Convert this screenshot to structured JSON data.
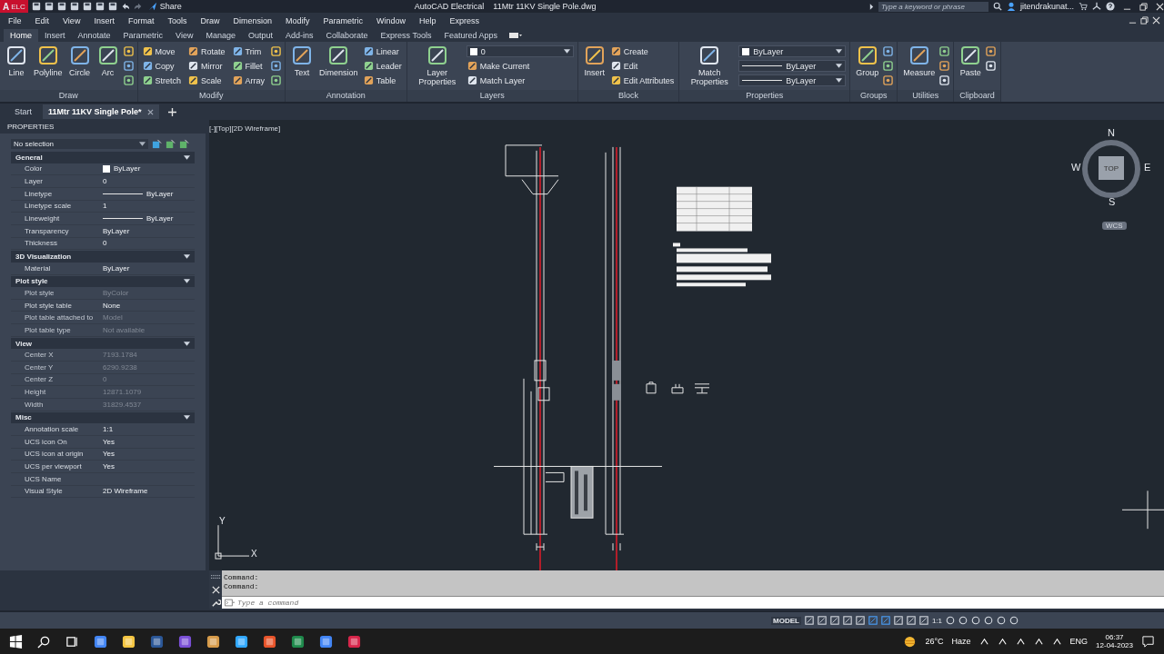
{
  "title_bar": {
    "app_letter": "A",
    "app_badge": "ELC",
    "share": "Share",
    "title": "AutoCAD Electrical    11Mtr 11KV Single Pole.dwg",
    "search": {
      "placeholder": "Type a keyword or phrase"
    },
    "user": "jitendrakunat..."
  },
  "menu": [
    "File",
    "Edit",
    "View",
    "Insert",
    "Format",
    "Tools",
    "Draw",
    "Dimension",
    "Modify",
    "Parametric",
    "Window",
    "Help",
    "Express"
  ],
  "ribbon_tabs": [
    {
      "label": "Home",
      "selected": true
    },
    {
      "label": "Insert",
      "selected": false
    },
    {
      "label": "Annotate",
      "selected": false
    },
    {
      "label": "Parametric",
      "selected": false
    },
    {
      "label": "View",
      "selected": false
    },
    {
      "label": "Manage",
      "selected": false
    },
    {
      "label": "Output",
      "selected": false
    },
    {
      "label": "Add-ins",
      "selected": false
    },
    {
      "label": "Collaborate",
      "selected": false
    },
    {
      "label": "Express Tools",
      "selected": false
    },
    {
      "label": "Featured Apps",
      "selected": false
    }
  ],
  "ribbon_panels": [
    {
      "title": "Draw",
      "large": [
        "Line",
        "Polyline",
        "Circle",
        "Arc"
      ],
      "small": [
        {
          "kind": "icon"
        },
        {
          "kind": "icon"
        },
        {
          "kind": "icon"
        }
      ]
    },
    {
      "title": "Modify",
      "small": [
        {
          "kind": "tool",
          "label": "Move"
        },
        {
          "kind": "tool",
          "label": "Copy"
        },
        {
          "kind": "tool",
          "label": "Stretch"
        },
        {
          "kind": "tool",
          "label": "Rotate"
        },
        {
          "kind": "tool",
          "label": "Mirror"
        },
        {
          "kind": "tool",
          "label": "Scale"
        },
        {
          "kind": "tool",
          "label": "Trim"
        },
        {
          "kind": "tool",
          "label": "Fillet"
        },
        {
          "kind": "tool",
          "label": "Array"
        },
        {
          "kind": "icon"
        },
        {
          "kind": "icon"
        },
        {
          "kind": "icon"
        }
      ]
    },
    {
      "title": "Annotation",
      "large": [
        "Text",
        "Dimension"
      ],
      "small": [
        {
          "kind": "tool",
          "label": "Linear"
        },
        {
          "kind": "tool",
          "label": "Leader"
        },
        {
          "kind": "tool",
          "label": "Table"
        }
      ]
    },
    {
      "title": "Layers",
      "large": [
        "Layer Properties"
      ],
      "small": [
        {
          "kind": "color-dropdown",
          "value": "0"
        },
        {
          "kind": "tool",
          "label": "Make Current"
        },
        {
          "kind": "tool",
          "label": "Match Layer"
        }
      ]
    },
    {
      "title": "Block",
      "large": [
        "Insert"
      ],
      "small": [
        {
          "kind": "tool",
          "label": "Create"
        },
        {
          "kind": "tool",
          "label": "Edit"
        },
        {
          "kind": "tool",
          "label": "Edit Attributes"
        }
      ]
    },
    {
      "title": "Properties",
      "large": [
        "Match Properties"
      ],
      "small": [
        {
          "kind": "color-dropdown",
          "value": "ByLayer"
        },
        {
          "kind": "line-dropdown",
          "value": "ByLayer"
        },
        {
          "kind": "line-dropdown",
          "value": "ByLayer"
        }
      ]
    },
    {
      "title": "Groups",
      "large": [
        "Group"
      ],
      "small": [
        {
          "kind": "icon"
        },
        {
          "kind": "icon"
        },
        {
          "kind": "icon"
        }
      ]
    },
    {
      "title": "Utilities",
      "large": [
        "Measure"
      ],
      "small": [
        {
          "kind": "icon"
        },
        {
          "kind": "icon"
        },
        {
          "kind": "icon"
        }
      ]
    },
    {
      "title": "Clipboard",
      "large": [
        "Paste"
      ],
      "small": [
        {
          "kind": "icon"
        },
        {
          "kind": "icon"
        }
      ]
    }
  ],
  "file_tabs": [
    {
      "label": "Start",
      "selected": false
    },
    {
      "label": "11Mtr 11KV Single Pole*",
      "selected": true
    }
  ],
  "properties": {
    "header": "PROPERTIES",
    "selection": "No selection",
    "sections": [
      {
        "title": "General",
        "rows": [
          {
            "label": "Color",
            "value": "ByLayer",
            "kind": "swatch",
            "dimmed": false
          },
          {
            "label": "Layer",
            "value": "0",
            "kind": "text",
            "dimmed": false
          },
          {
            "label": "Linetype",
            "value": "ByLayer",
            "kind": "line",
            "dimmed": false
          },
          {
            "label": "Linetype scale",
            "value": "1",
            "kind": "text",
            "dimmed": false
          },
          {
            "label": "Lineweight",
            "value": "ByLayer",
            "kind": "line",
            "dimmed": false
          },
          {
            "label": "Transparency",
            "value": "ByLayer",
            "kind": "text",
            "dimmed": false
          },
          {
            "label": "Thickness",
            "value": "0",
            "kind": "text",
            "dimmed": false
          }
        ]
      },
      {
        "title": "3D Visualization",
        "rows": [
          {
            "label": "Material",
            "value": "ByLayer",
            "kind": "text",
            "dimmed": false
          }
        ]
      },
      {
        "title": "Plot style",
        "rows": [
          {
            "label": "Plot style",
            "value": "ByColor",
            "kind": "text",
            "dimmed": true
          },
          {
            "label": "Plot style table",
            "value": "None",
            "kind": "text",
            "dimmed": false
          },
          {
            "label": "Plot table attached to",
            "value": "Model",
            "kind": "text",
            "dimmed": true
          },
          {
            "label": "Plot table type",
            "value": "Not available",
            "kind": "text",
            "dimmed": true
          }
        ]
      },
      {
        "title": "View",
        "rows": [
          {
            "label": "Center X",
            "value": "7193.1784",
            "kind": "text",
            "dimmed": true
          },
          {
            "label": "Center Y",
            "value": "6290.9238",
            "kind": "text",
            "dimmed": true
          },
          {
            "label": "Center Z",
            "value": "0",
            "kind": "text",
            "dimmed": true
          },
          {
            "label": "Height",
            "value": "12871.1079",
            "kind": "text",
            "dimmed": true
          },
          {
            "label": "Width",
            "value": "31829.4537",
            "kind": "text",
            "dimmed": true
          }
        ]
      },
      {
        "title": "Misc",
        "rows": [
          {
            "label": "Annotation scale",
            "value": "1:1",
            "kind": "text",
            "dimmed": false
          },
          {
            "label": "UCS icon On",
            "value": "Yes",
            "kind": "text",
            "dimmed": false
          },
          {
            "label": "UCS icon at origin",
            "value": "Yes",
            "kind": "text",
            "dimmed": false
          },
          {
            "label": "UCS per viewport",
            "value": "Yes",
            "kind": "text",
            "dimmed": false
          },
          {
            "label": "UCS Name",
            "dimmed": false
          },
          {
            "label": "Visual Style",
            "value": "2D Wireframe",
            "kind": "text",
            "dimmed": false
          }
        ]
      }
    ]
  },
  "viewport": {
    "label": "[-][Top][2D Wireframe]",
    "viewcube": {
      "north": "N",
      "south": "S",
      "east": "E",
      "west": "W",
      "face": "TOP",
      "ucs": "WCS"
    },
    "ucs_icon": {
      "x": "X",
      "y": "Y"
    }
  },
  "command": {
    "history": [
      "Command:",
      "Command:"
    ],
    "placeholder": "Type a command"
  },
  "status_bar": {
    "space": "MODEL",
    "scale": "1:1"
  },
  "taskbar": {
    "temperature": "26°C",
    "condition": "Haze",
    "language": "ENG",
    "time": "06:37",
    "date": "12-04-2023"
  }
}
